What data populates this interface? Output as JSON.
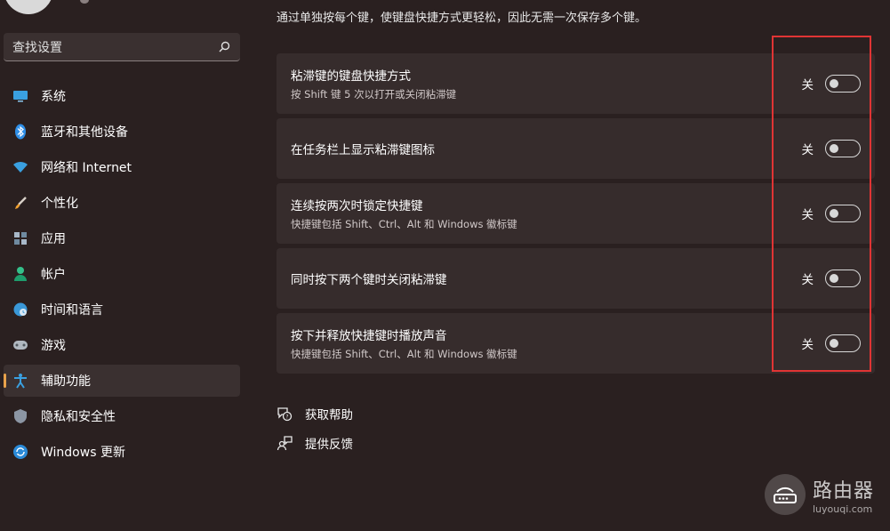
{
  "description": "通过单独按每个键，使键盘快捷方式更轻松，因此无需一次保存多个键。",
  "search": {
    "placeholder": "查找设置",
    "icon": "search-icon"
  },
  "nav": {
    "items": [
      {
        "label": "系统",
        "icon": "display-icon"
      },
      {
        "label": "蓝牙和其他设备",
        "icon": "bluetooth-icon"
      },
      {
        "label": "网络和 Internet",
        "icon": "wifi-icon"
      },
      {
        "label": "个性化",
        "icon": "paintbrush-icon"
      },
      {
        "label": "应用",
        "icon": "apps-icon"
      },
      {
        "label": "帐户",
        "icon": "person-icon"
      },
      {
        "label": "时间和语言",
        "icon": "globe-clock-icon"
      },
      {
        "label": "游戏",
        "icon": "gamepad-icon"
      },
      {
        "label": "辅助功能",
        "icon": "accessibility-icon",
        "active": true
      },
      {
        "label": "隐私和安全性",
        "icon": "shield-icon"
      },
      {
        "label": "Windows 更新",
        "icon": "update-icon"
      }
    ]
  },
  "settings": [
    {
      "title": "粘滞键的键盘快捷方式",
      "subtitle": "按 Shift 键 5 次以打开或关闭粘滞键",
      "state": "关",
      "on": false
    },
    {
      "title": "在任务栏上显示粘滞键图标",
      "subtitle": "",
      "state": "关",
      "on": false
    },
    {
      "title": "连续按两次时锁定快捷键",
      "subtitle": "快捷键包括 Shift、Ctrl、Alt 和 Windows 徽标键",
      "state": "关",
      "on": false
    },
    {
      "title": "同时按下两个键时关闭粘滞键",
      "subtitle": "",
      "state": "关",
      "on": false
    },
    {
      "title": "按下并释放快捷键时播放声音",
      "subtitle": "快捷键包括 Shift、Ctrl、Alt 和 Windows 徽标键",
      "state": "关",
      "on": false
    }
  ],
  "links": {
    "help": {
      "label": "获取帮助",
      "icon": "help-icon"
    },
    "feedback": {
      "label": "提供反馈",
      "icon": "feedback-icon"
    }
  },
  "watermark": {
    "name": "路由器",
    "url": "luyouqi.com"
  },
  "colors": {
    "background": "#2a2020",
    "card": "#362c2c",
    "accent": "#e8a24b",
    "highlight_border": "#e03434"
  }
}
